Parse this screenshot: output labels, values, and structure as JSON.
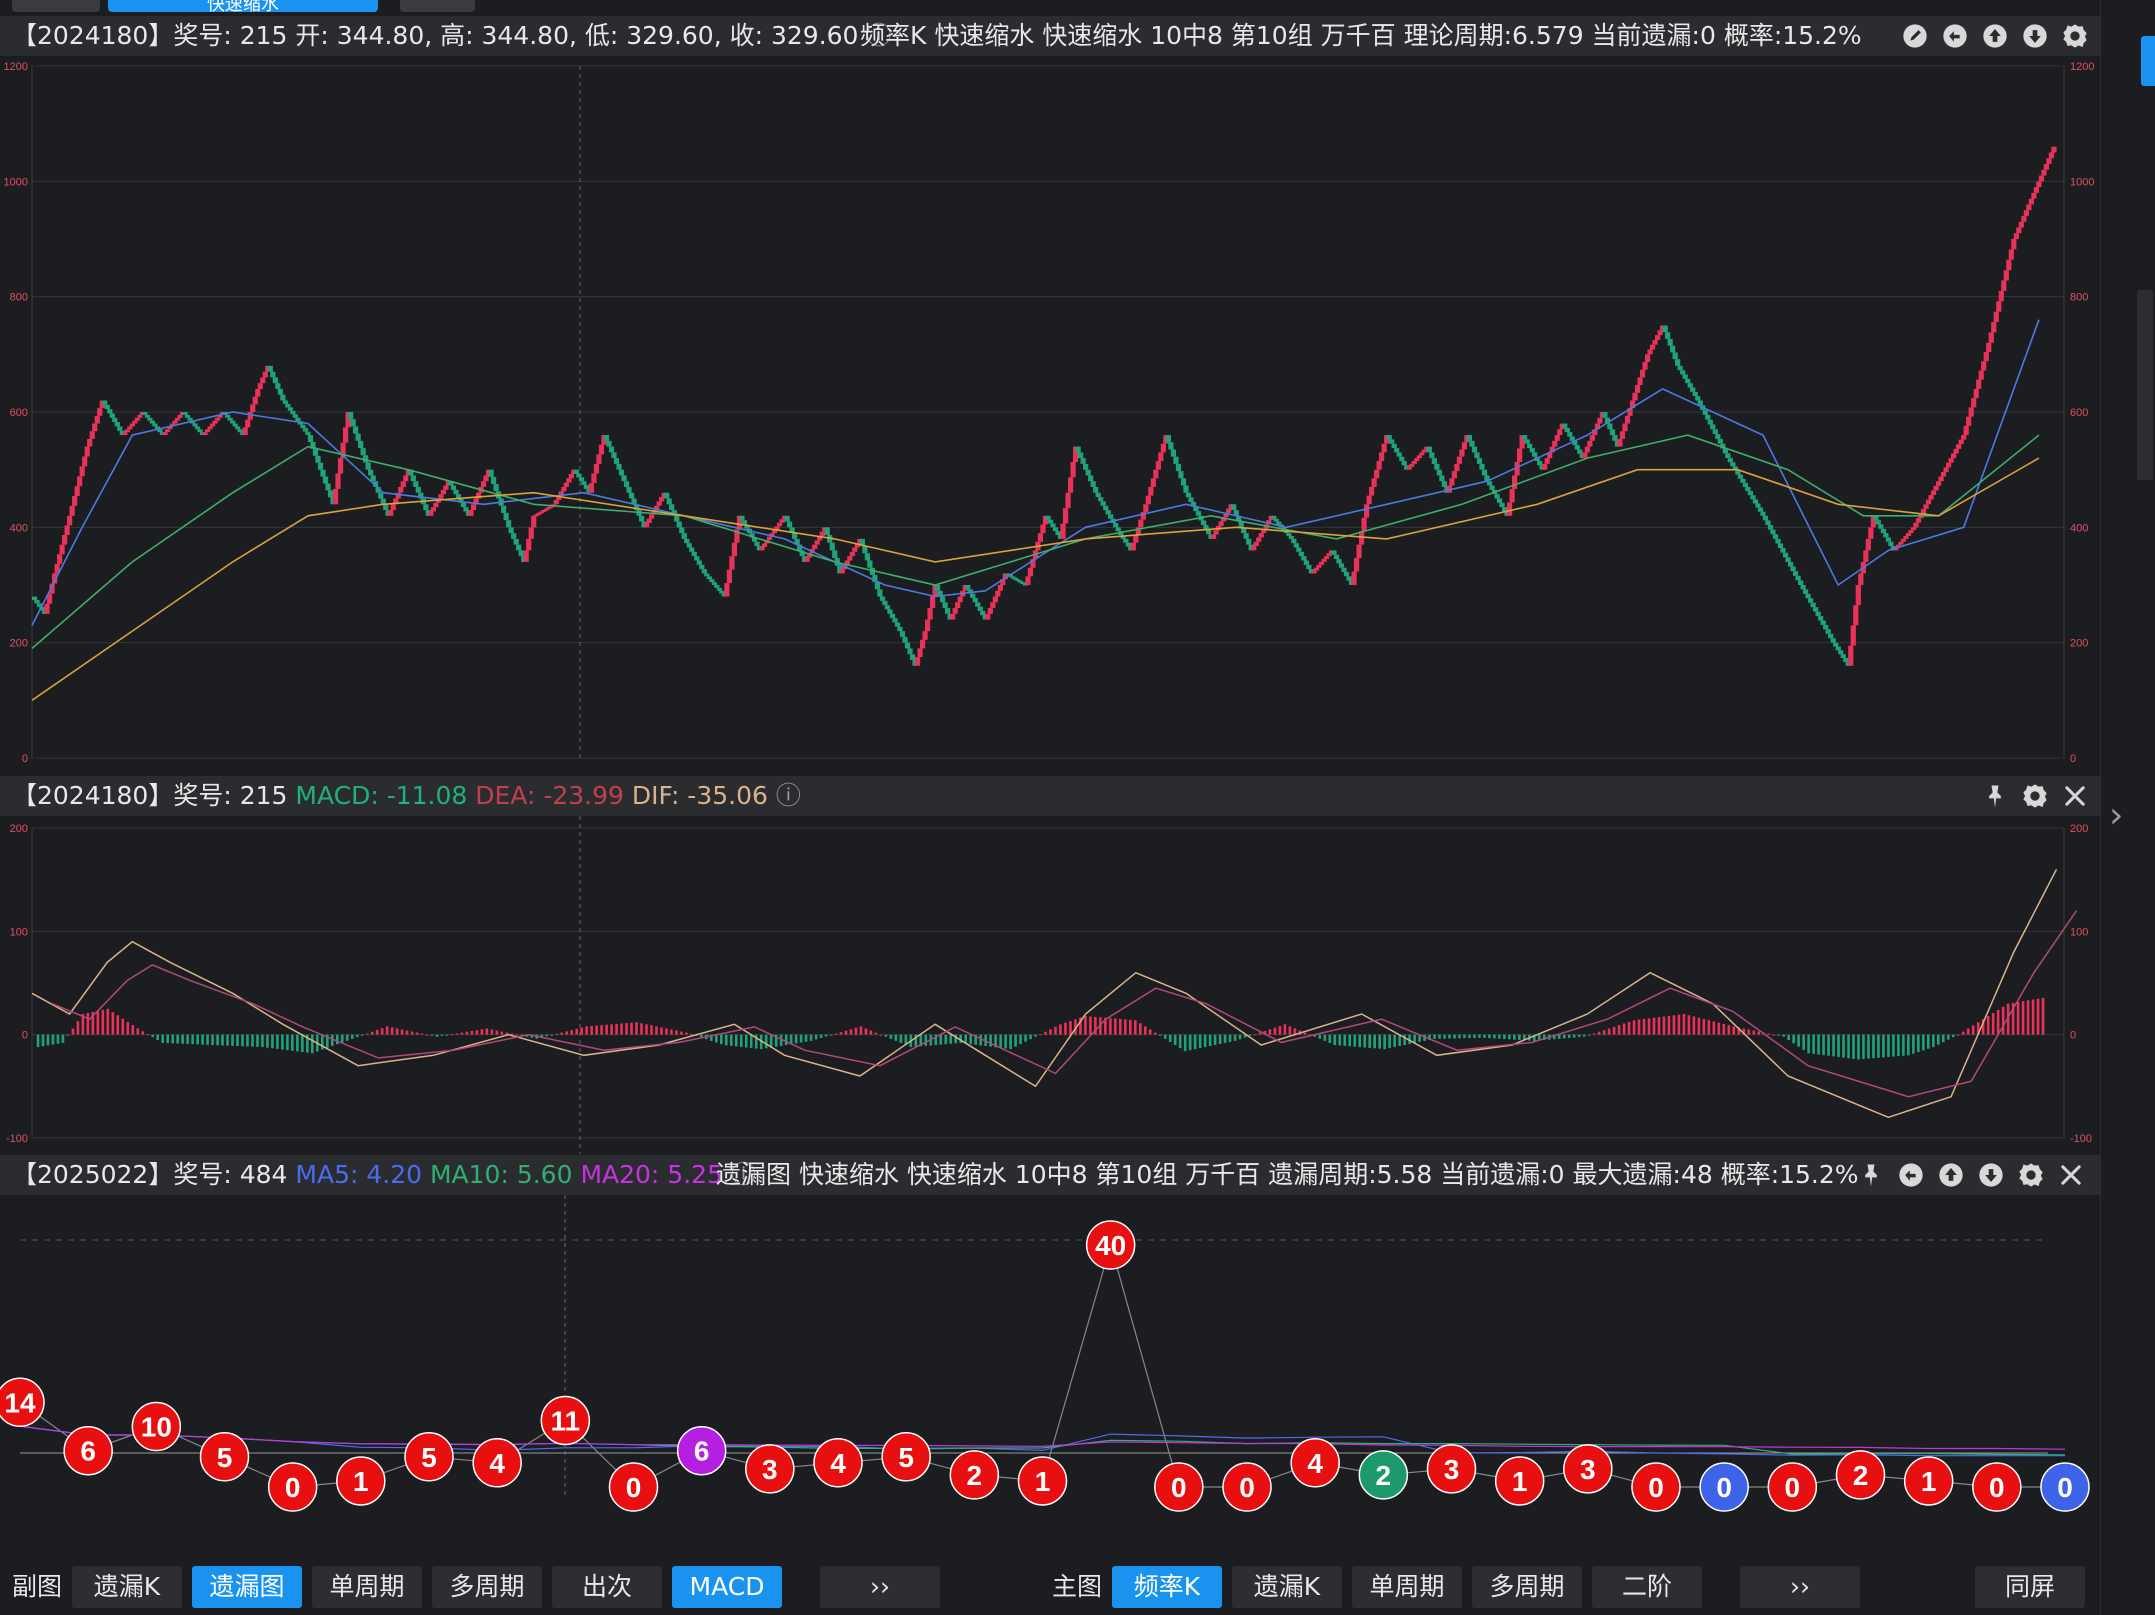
{
  "top_tabs": {
    "active_label": "快速缩水"
  },
  "main_panel": {
    "header": {
      "period_info": "【2024180】奖号: 215",
      "ohlc": "开: 344.80, 高: 344.80, 低: 329.60, 收: 329.60",
      "indicators": "频率K   快速缩水   快速缩水 10中8 第10组   万千百   理论周期:6.579   当前遗漏:0   概率:15.2%"
    },
    "icons": [
      "edit-icon",
      "undo-icon",
      "arrow-up-icon",
      "arrow-down-icon",
      "settings-icon"
    ]
  },
  "macd_panel": {
    "header": {
      "period_info": "【2024180】奖号: 215",
      "macd": "MACD: -11.08",
      "dea": "DEA: -23.99",
      "dif": "DIF: -35.06"
    },
    "icons": [
      "pin-icon",
      "settings-icon",
      "close-icon"
    ]
  },
  "omission_panel": {
    "header": {
      "period_info": "【2025022】奖号: 484",
      "ma5": "MA5: 4.20",
      "ma10": "MA10: 5.60",
      "ma20": "MA20: 5.25",
      "info": "遗漏图   快速缩水   快速缩水 10中8 第10组   万千百   遗漏周期:5.58   当前遗漏:0   最大遗漏:48   概率:15.2%"
    },
    "icons": [
      "pin-icon",
      "undo-icon",
      "arrow-up-icon",
      "arrow-down-icon",
      "settings-icon",
      "close-icon"
    ]
  },
  "bottom_bar": {
    "sub_label": "副图",
    "sub_buttons": [
      "遗漏K",
      "遗漏图",
      "单周期",
      "多周期",
      "出次",
      "MACD"
    ],
    "sub_active": [
      "遗漏图",
      "MACD"
    ],
    "more1": "››",
    "main_label": "主图",
    "main_buttons": [
      "频率K",
      "遗漏K",
      "单周期",
      "多周期",
      "二阶"
    ],
    "main_active": [
      "频率K"
    ],
    "more2": "››",
    "sync": "同屏"
  },
  "colors": {
    "up": "#e8325a",
    "down": "#1fa37a",
    "ma_blue": "#4a7be0",
    "ma_green": "#3fae6a",
    "ma_orange": "#d9a23a",
    "ball_red": "#e80f10",
    "ball_green": "#1d9a6c",
    "ball_blue": "#3d63e8",
    "ball_purple": "#b41fe0"
  },
  "chart_data": [
    {
      "type": "line",
      "name": "频率K main chart",
      "ylim": [
        0,
        1200
      ],
      "yticks": [
        0,
        200,
        400,
        600,
        800,
        1000,
        1200
      ],
      "trend": [
        [
          0,
          280
        ],
        [
          5,
          250
        ],
        [
          9,
          320
        ],
        [
          15,
          420
        ],
        [
          22,
          540
        ],
        [
          28,
          620
        ],
        [
          36,
          560
        ],
        [
          44,
          600
        ],
        [
          52,
          560
        ],
        [
          60,
          600
        ],
        [
          68,
          560
        ],
        [
          76,
          600
        ],
        [
          84,
          560
        ],
        [
          90,
          640
        ],
        [
          94,
          680
        ],
        [
          100,
          620
        ],
        [
          110,
          560
        ],
        [
          120,
          440
        ],
        [
          126,
          600
        ],
        [
          134,
          500
        ],
        [
          142,
          420
        ],
        [
          150,
          500
        ],
        [
          158,
          420
        ],
        [
          166,
          480
        ],
        [
          174,
          420
        ],
        [
          182,
          500
        ],
        [
          190,
          400
        ],
        [
          196,
          340
        ],
        [
          200,
          420
        ],
        [
          208,
          440
        ],
        [
          216,
          500
        ],
        [
          222,
          460
        ],
        [
          228,
          560
        ],
        [
          236,
          480
        ],
        [
          244,
          400
        ],
        [
          252,
          460
        ],
        [
          260,
          380
        ],
        [
          268,
          320
        ],
        [
          276,
          280
        ],
        [
          282,
          420
        ],
        [
          290,
          360
        ],
        [
          300,
          420
        ],
        [
          308,
          340
        ],
        [
          316,
          400
        ],
        [
          322,
          320
        ],
        [
          330,
          380
        ],
        [
          338,
          280
        ],
        [
          346,
          220
        ],
        [
          352,
          160
        ],
        [
          356,
          220
        ],
        [
          360,
          300
        ],
        [
          366,
          240
        ],
        [
          372,
          300
        ],
        [
          380,
          240
        ],
        [
          388,
          320
        ],
        [
          396,
          300
        ],
        [
          404,
          420
        ],
        [
          410,
          380
        ],
        [
          416,
          540
        ],
        [
          424,
          460
        ],
        [
          432,
          400
        ],
        [
          438,
          360
        ],
        [
          444,
          440
        ],
        [
          452,
          560
        ],
        [
          460,
          460
        ],
        [
          470,
          380
        ],
        [
          478,
          440
        ],
        [
          486,
          360
        ],
        [
          494,
          420
        ],
        [
          502,
          380
        ],
        [
          510,
          320
        ],
        [
          518,
          360
        ],
        [
          526,
          300
        ],
        [
          532,
          440
        ],
        [
          540,
          560
        ],
        [
          548,
          500
        ],
        [
          556,
          540
        ],
        [
          564,
          460
        ],
        [
          572,
          560
        ],
        [
          580,
          480
        ],
        [
          588,
          420
        ],
        [
          594,
          560
        ],
        [
          602,
          500
        ],
        [
          610,
          580
        ],
        [
          618,
          520
        ],
        [
          626,
          600
        ],
        [
          632,
          540
        ],
        [
          638,
          620
        ],
        [
          644,
          700
        ],
        [
          650,
          750
        ],
        [
          656,
          680
        ],
        [
          664,
          620
        ],
        [
          676,
          520
        ],
        [
          690,
          420
        ],
        [
          705,
          300
        ],
        [
          718,
          200
        ],
        [
          724,
          160
        ],
        [
          728,
          300
        ],
        [
          734,
          420
        ],
        [
          742,
          360
        ],
        [
          750,
          400
        ],
        [
          760,
          480
        ],
        [
          770,
          560
        ],
        [
          780,
          720
        ],
        [
          790,
          900
        ],
        [
          800,
          1000
        ],
        [
          806,
          1060
        ]
      ],
      "ma_series": [
        {
          "color": "ma_blue",
          "points": [
            [
              0,
              230
            ],
            [
              20,
              400
            ],
            [
              40,
              560
            ],
            [
              80,
              600
            ],
            [
              110,
              580
            ],
            [
              140,
              460
            ],
            [
              180,
              440
            ],
            [
              220,
              460
            ],
            [
              260,
              420
            ],
            [
              300,
              380
            ],
            [
              340,
              300
            ],
            [
              360,
              280
            ],
            [
              380,
              290
            ],
            [
              420,
              400
            ],
            [
              460,
              440
            ],
            [
              500,
              400
            ],
            [
              540,
              440
            ],
            [
              580,
              480
            ],
            [
              620,
              560
            ],
            [
              650,
              640
            ],
            [
              690,
              560
            ],
            [
              720,
              300
            ],
            [
              740,
              360
            ],
            [
              770,
              400
            ],
            [
              800,
              760
            ]
          ]
        },
        {
          "color": "ma_green",
          "points": [
            [
              0,
              190
            ],
            [
              40,
              340
            ],
            [
              80,
              460
            ],
            [
              110,
              540
            ],
            [
              150,
              500
            ],
            [
              200,
              440
            ],
            [
              260,
              420
            ],
            [
              320,
              340
            ],
            [
              360,
              300
            ],
            [
              420,
              380
            ],
            [
              470,
              420
            ],
            [
              520,
              380
            ],
            [
              570,
              440
            ],
            [
              620,
              520
            ],
            [
              660,
              560
            ],
            [
              700,
              500
            ],
            [
              730,
              420
            ],
            [
              760,
              420
            ],
            [
              800,
              560
            ]
          ]
        },
        {
          "color": "ma_orange",
          "points": [
            [
              0,
              100
            ],
            [
              40,
              220
            ],
            [
              80,
              340
            ],
            [
              110,
              420
            ],
            [
              140,
              440
            ],
            [
              200,
              460
            ],
            [
              260,
              420
            ],
            [
              320,
              380
            ],
            [
              360,
              340
            ],
            [
              420,
              380
            ],
            [
              480,
              400
            ],
            [
              540,
              380
            ],
            [
              600,
              440
            ],
            [
              640,
              500
            ],
            [
              680,
              500
            ],
            [
              720,
              440
            ],
            [
              760,
              420
            ],
            [
              800,
              520
            ]
          ]
        }
      ]
    },
    {
      "type": "bar",
      "name": "MACD",
      "ylim": [
        -100,
        200
      ],
      "yticks": [
        -100,
        0,
        100,
        200
      ],
      "legend": [
        "MACD",
        "DEA",
        "DIF"
      ]
    },
    {
      "type": "scatter",
      "name": "遗漏图",
      "values": [
        14,
        6,
        10,
        5,
        0,
        1,
        5,
        4,
        11,
        0,
        6,
        3,
        4,
        5,
        2,
        1,
        40,
        0,
        0,
        4,
        2,
        3,
        1,
        3,
        0,
        0,
        0,
        2,
        1,
        0,
        0
      ],
      "ball_colors": [
        "red",
        "red",
        "red",
        "red",
        "red",
        "red",
        "red",
        "red",
        "red",
        "red",
        "purple",
        "red",
        "red",
        "red",
        "red",
        "red",
        "red",
        "red",
        "red",
        "red",
        "green",
        "red",
        "red",
        "red",
        "red",
        "blue",
        "red",
        "red",
        "red",
        "red",
        "blue"
      ],
      "legend": [
        "MA5",
        "MA10",
        "MA20"
      ]
    }
  ]
}
